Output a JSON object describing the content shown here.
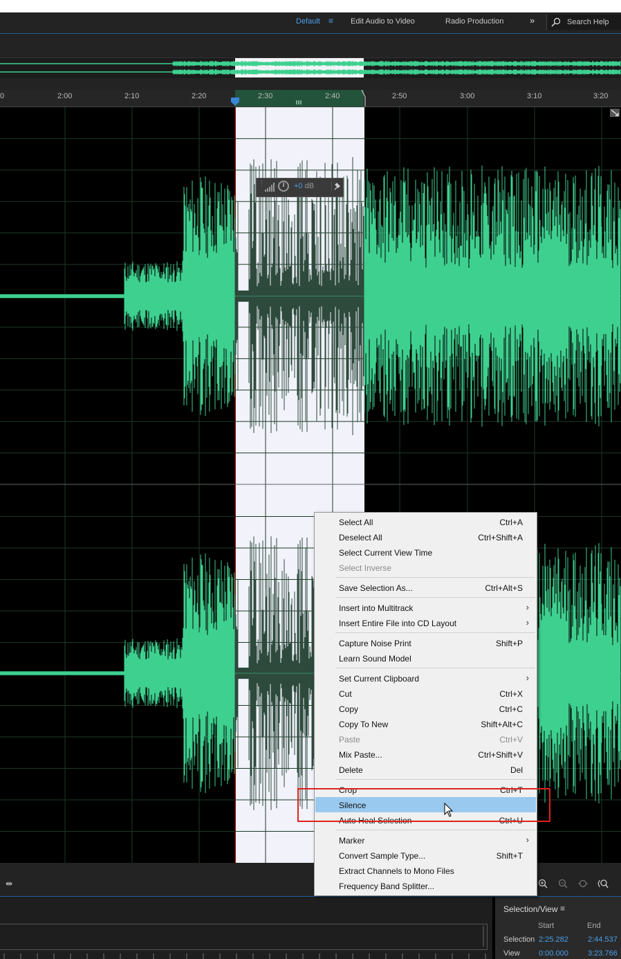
{
  "workspace": {
    "tabs": [
      {
        "label": "Default",
        "active": true
      },
      {
        "label": "Edit Audio to Video",
        "active": false
      },
      {
        "label": "Radio Production",
        "active": false
      }
    ],
    "menu_glyph": "≡",
    "overflow_glyph": "»",
    "search_label": "Search Help"
  },
  "ruler": {
    "ticks": [
      "0",
      "2:00",
      "2:10",
      "2:20",
      "2:30",
      "2:40",
      "2:50",
      "3:00",
      "3:10",
      "3:20"
    ]
  },
  "hud": {
    "value_num": "+0",
    "value_unit": " dB"
  },
  "context_menu": {
    "items": [
      {
        "label": "Select All",
        "shortcut": "Ctrl+A"
      },
      {
        "label": "Deselect All",
        "shortcut": "Ctrl+Shift+A"
      },
      {
        "label": "Select Current View Time",
        "shortcut": ""
      },
      {
        "label": "Select Inverse",
        "shortcut": "",
        "disabled": true
      },
      {
        "label": "Save Selection As...",
        "shortcut": "Ctrl+Alt+S"
      },
      {
        "label": "Insert into Multitrack",
        "shortcut": "",
        "submenu": true
      },
      {
        "label": "Insert Entire File into CD Layout",
        "shortcut": "",
        "submenu": true
      },
      {
        "label": "Capture Noise Print",
        "shortcut": "Shift+P"
      },
      {
        "label": "Learn Sound Model",
        "shortcut": ""
      },
      {
        "label": "Set Current Clipboard",
        "shortcut": "",
        "submenu": true
      },
      {
        "label": "Cut",
        "shortcut": "Ctrl+X"
      },
      {
        "label": "Copy",
        "shortcut": "Ctrl+C"
      },
      {
        "label": "Copy To New",
        "shortcut": "Shift+Alt+C"
      },
      {
        "label": "Paste",
        "shortcut": "Ctrl+V",
        "disabled": true
      },
      {
        "label": "Mix Paste...",
        "shortcut": "Ctrl+Shift+V"
      },
      {
        "label": "Delete",
        "shortcut": "Del"
      },
      {
        "label": "Crop",
        "shortcut": "Ctrl+T"
      },
      {
        "label": "Silence",
        "shortcut": "",
        "highlighted": true
      },
      {
        "label": "Auto Heal Selection",
        "shortcut": "Ctrl+U"
      },
      {
        "label": "Marker",
        "shortcut": "",
        "submenu": true
      },
      {
        "label": "Convert Sample Type...",
        "shortcut": "Shift+T"
      },
      {
        "label": "Extract Channels to Mono Files",
        "shortcut": ""
      },
      {
        "label": "Frequency Band Splitter...",
        "shortcut": ""
      }
    ],
    "submenu_glyph": "›"
  },
  "selection_view": {
    "title": "Selection/View",
    "menu_glyph": "≡",
    "col_start": "Start",
    "col_end": "End",
    "rows": [
      {
        "label": "Selection",
        "start": "2:25.282",
        "end": "2:44.537"
      },
      {
        "label": "View",
        "start": "0:00.000",
        "end": "3:23.766"
      }
    ]
  },
  "colors": {
    "accent": "#4a9fe8",
    "waveform": "#3ed08f",
    "waveform_selected": "#2d4a3c",
    "selection_bg": "#f1f2fa",
    "highlight_box": "#e02020"
  },
  "toolbar": {
    "left_glyph": "⇹"
  }
}
